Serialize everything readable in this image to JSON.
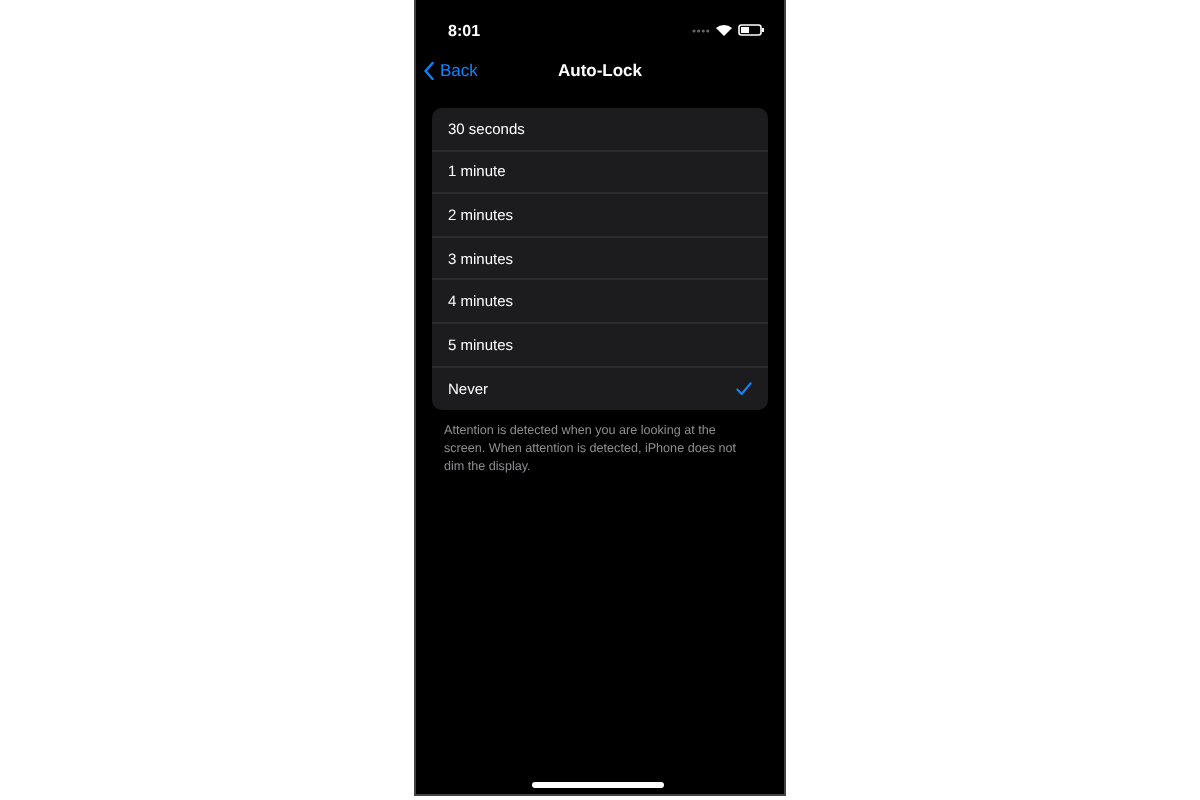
{
  "status_bar": {
    "time": "8:01"
  },
  "nav": {
    "back": "Back",
    "title": "Auto-Lock"
  },
  "options": [
    {
      "label": "30 seconds",
      "selected": false
    },
    {
      "label": "1 minute",
      "selected": false
    },
    {
      "label": "2 minutes",
      "selected": false
    },
    {
      "label": "3 minutes",
      "selected": false
    },
    {
      "label": "4 minutes",
      "selected": false
    },
    {
      "label": "5 minutes",
      "selected": false
    },
    {
      "label": "Never",
      "selected": true
    }
  ],
  "footnote": "Attention is detected when you are looking at the screen. When attention is detected, iPhone does not dim the display."
}
